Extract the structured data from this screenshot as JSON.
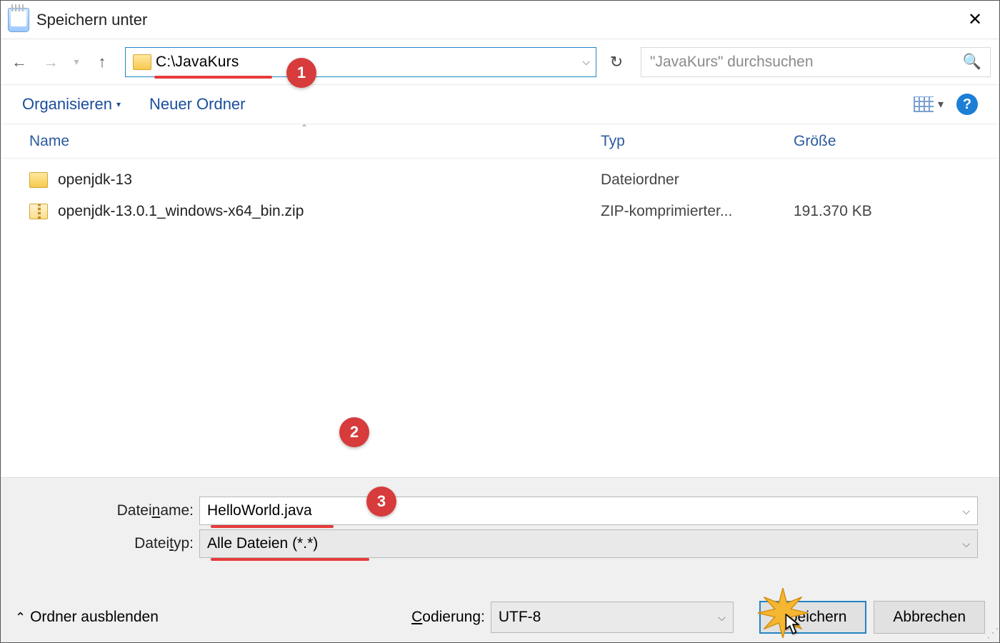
{
  "window": {
    "title": "Speichern unter"
  },
  "nav": {
    "address": "C:\\JavaKurs",
    "search_placeholder": "\"JavaKurs\" durchsuchen"
  },
  "toolbar": {
    "organize": "Organisieren",
    "new_folder": "Neuer Ordner"
  },
  "columns": {
    "name": "Name",
    "type": "Typ",
    "size": "Größe"
  },
  "files": [
    {
      "name": "openjdk-13",
      "type": "Dateiordner",
      "size": "",
      "icon": "folder"
    },
    {
      "name": "openjdk-13.0.1_windows-x64_bin.zip",
      "type": "ZIP-komprimierter...",
      "size": "191.370 KB",
      "icon": "zip"
    }
  ],
  "form": {
    "filename_label": "Dateiname:",
    "filename_value": "HelloWorld.java",
    "filetype_label": "Dateityp:",
    "filetype_value": "Alle Dateien  (*.*)",
    "encoding_label": "Codierung:",
    "encoding_value": "UTF-8"
  },
  "actions": {
    "hide_folders": "Ordner ausblenden",
    "save": "Speichern",
    "cancel": "Abbrechen"
  },
  "callouts": {
    "c1": "1",
    "c2": "2",
    "c3": "3"
  }
}
